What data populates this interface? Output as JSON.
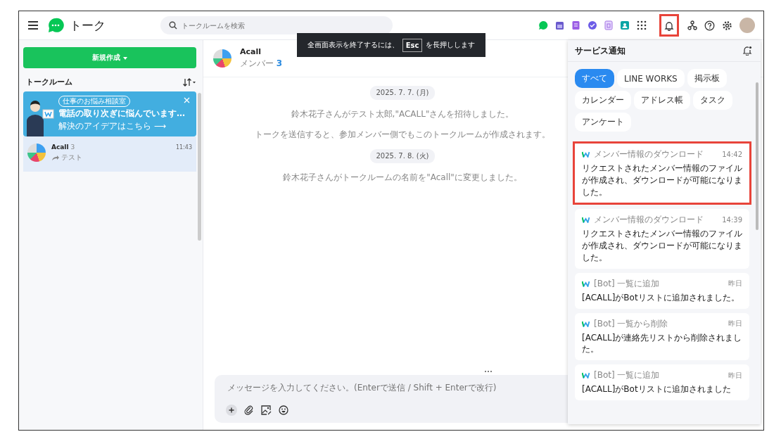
{
  "header": {
    "title": "トーク",
    "search_placeholder": "トークルームを検索",
    "bell_highlighted": true
  },
  "toast": {
    "before": "全画面表示を終了するには、",
    "key": "Esc",
    "after": "を長押しします"
  },
  "sidebar": {
    "new_button": "新規作成",
    "section_title": "トークルーム",
    "banner": {
      "tag": "仕事のお悩み相談室",
      "headline": "電話の取り次ぎに悩んでいます…",
      "link": "解決のアイデアはこちら ⟶"
    },
    "rooms": [
      {
        "name": "Acall",
        "count": "3",
        "time": "11:43",
        "preview": "テスト",
        "selected": true
      }
    ]
  },
  "chat": {
    "title": "Acall",
    "members_label": "メンバー",
    "members_count": "3",
    "messages": [
      {
        "kind": "date",
        "text": "2025. 7. 7. (月)"
      },
      {
        "kind": "system",
        "text": "鈴木花子さんがテスト太郎,\"ACALL\"さんを招待しました。"
      },
      {
        "kind": "system",
        "text": "トークを送信すると、参加メンバー側でもこのトークルームが作成されます。"
      },
      {
        "kind": "date",
        "text": "2025. 7. 8. (火)"
      },
      {
        "kind": "system",
        "text": "鈴木花子さんがトークルームの名前を\"Acall\"に変更しました。"
      }
    ],
    "input_placeholder": "メッセージを入力してください。(Enterで送信 / Shift + Enterで改行)"
  },
  "notifications": {
    "title": "サービス通知",
    "filters": [
      {
        "label": "すべて",
        "selected": true
      },
      {
        "label": "LINE WORKS",
        "selected": false
      },
      {
        "label": "掲示板",
        "selected": false
      },
      {
        "label": "カレンダー",
        "selected": false
      },
      {
        "label": "アドレス帳",
        "selected": false
      },
      {
        "label": "タスク",
        "selected": false
      },
      {
        "label": "アンケート",
        "selected": false
      }
    ],
    "items": [
      {
        "source": "メンバー情報のダウンロード",
        "time": "14:42",
        "body": "リクエストされたメンバー情報のファイルが作成され、ダウンロードが可能になりました。",
        "highlighted": true
      },
      {
        "source": "メンバー情報のダウンロード",
        "time": "14:39",
        "body": "リクエストされたメンバー情報のファイルが作成され、ダウンロードが可能になりました。",
        "highlighted": false
      },
      {
        "source": "[Bot] 一覧に追加",
        "time": "昨日",
        "body": "[ACALL]がBotリストに追加されました。",
        "highlighted": false
      },
      {
        "source": "[Bot] 一覧から削除",
        "time": "昨日",
        "body": "[ACALL]が連絡先リストから削除されました。",
        "highlighted": false
      },
      {
        "source": "[Bot] 一覧に追加",
        "time": "昨日",
        "body": "[ACALL]がBotリストに追加されました",
        "highlighted": false
      }
    ]
  }
}
